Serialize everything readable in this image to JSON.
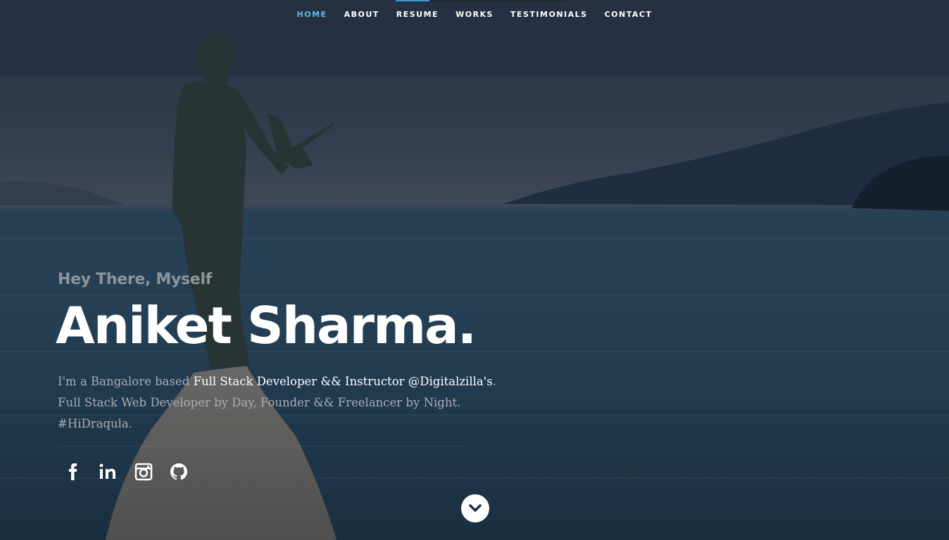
{
  "nav": {
    "items": [
      {
        "label": "HOME",
        "active": true
      },
      {
        "label": "ABOUT",
        "active": false
      },
      {
        "label": "RESUME",
        "active": false
      },
      {
        "label": "WORKS",
        "active": false
      },
      {
        "label": "TESTIMONIALS",
        "active": false
      },
      {
        "label": "CONTACT",
        "active": false
      }
    ],
    "active_color": "#63b7e6"
  },
  "scroll_progress": 0.2,
  "banner": {
    "intro": "Hey There, Myself",
    "name": "Aniket Sharma.",
    "desc_prefix": "I'm a Bangalore based ",
    "desc_highlight": "Full Stack Developer && Instructor @Digitalzilla's",
    "desc_suffix": ". Full Stack Web Developer by Day, Founder && Freelancer by Night. #HiDraqula."
  },
  "social": [
    {
      "icon": "facebook-icon"
    },
    {
      "icon": "linkedin-icon"
    },
    {
      "icon": "instagram-icon"
    },
    {
      "icon": "github-icon"
    }
  ],
  "scroll_button": {
    "icon": "chevron-down-icon"
  }
}
